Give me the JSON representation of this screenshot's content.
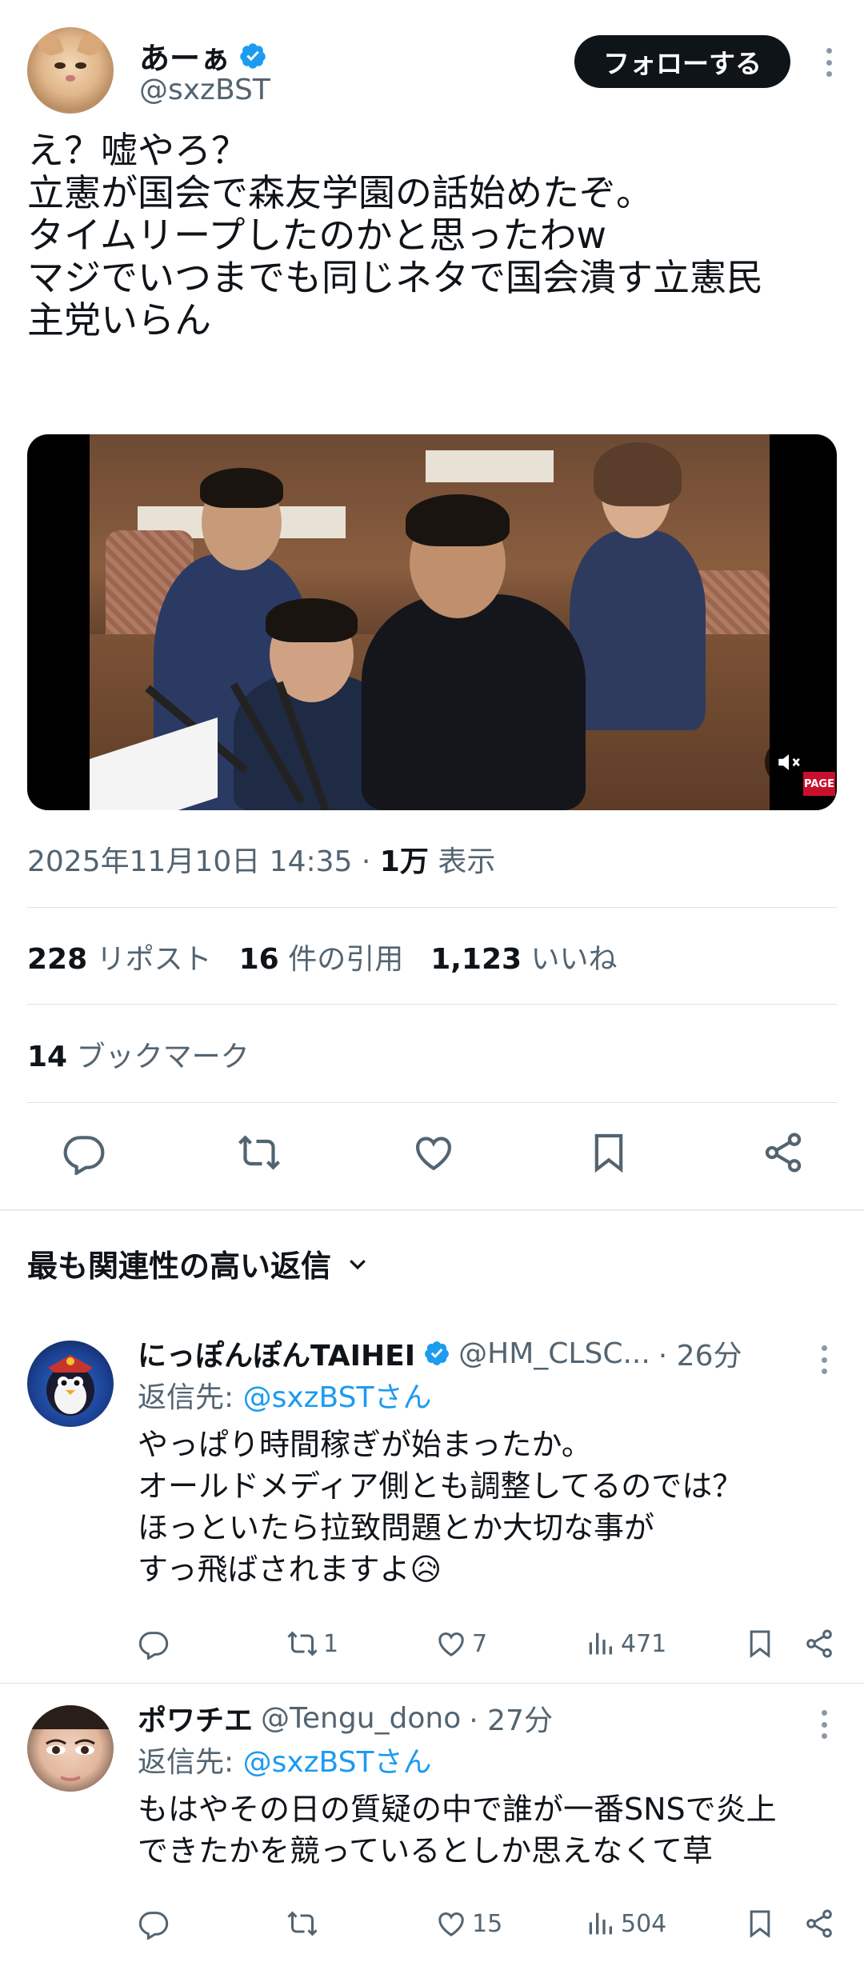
{
  "tweet": {
    "author_name": "あーぁ",
    "author_handle": "@sxzBST",
    "follow_label": "フォローする",
    "text_lines": [
      "え？嘘やろ？",
      "立憲が国会で森友学園の話始めたぞ。",
      "タイムリープしたのかと思ったわw",
      "マジでいつまでも同じネタで国会潰す立憲民",
      "主党いらん"
    ],
    "media_logo": "PAGE",
    "timestamp": "2025年11月10日 14:35",
    "separator": "·",
    "views_count": "1万",
    "views_label": "表示",
    "retweets_count": "228",
    "retweets_label": "リポスト",
    "quotes_count": "16",
    "quotes_label": "件の引用",
    "likes_count": "1,123",
    "likes_label": "いいね",
    "bookmarks_count": "14",
    "bookmarks_label": "ブックマーク"
  },
  "replies_header": "最も関連性の高い返信",
  "replies": [
    {
      "name": "にっぽんぽんTAIHEI",
      "handle": "@HM_CLSC...",
      "time": "· 26分",
      "reply_to_prefix": "返信先: ",
      "reply_to": "@sxzBSTさん",
      "text_lines": [
        "やっぱり時間稼ぎが始まったか。",
        "オールドメディア側とも調整してるのでは？",
        "ほっといたら拉致問題とか大切な事が",
        "すっ飛ばされますよ😥"
      ],
      "reply_count": "",
      "retweet_count": "1",
      "like_count": "7",
      "view_count": "471"
    },
    {
      "name": "ポワチエ",
      "handle": "@Tengu_dono",
      "time": "· 27分",
      "reply_to_prefix": "返信先: ",
      "reply_to": "@sxzBSTさん",
      "text_lines": [
        "もはやその日の質疑の中で誰が一番SNSで炎上",
        "できたかを競っているとしか思えなくて草"
      ],
      "reply_count": "",
      "retweet_count": "",
      "like_count": "15",
      "view_count": "504"
    }
  ],
  "colors": {
    "accent": "#1d9bf0",
    "text": "#0f1419",
    "secondary": "#536471",
    "follow_bg": "#0f1419"
  }
}
